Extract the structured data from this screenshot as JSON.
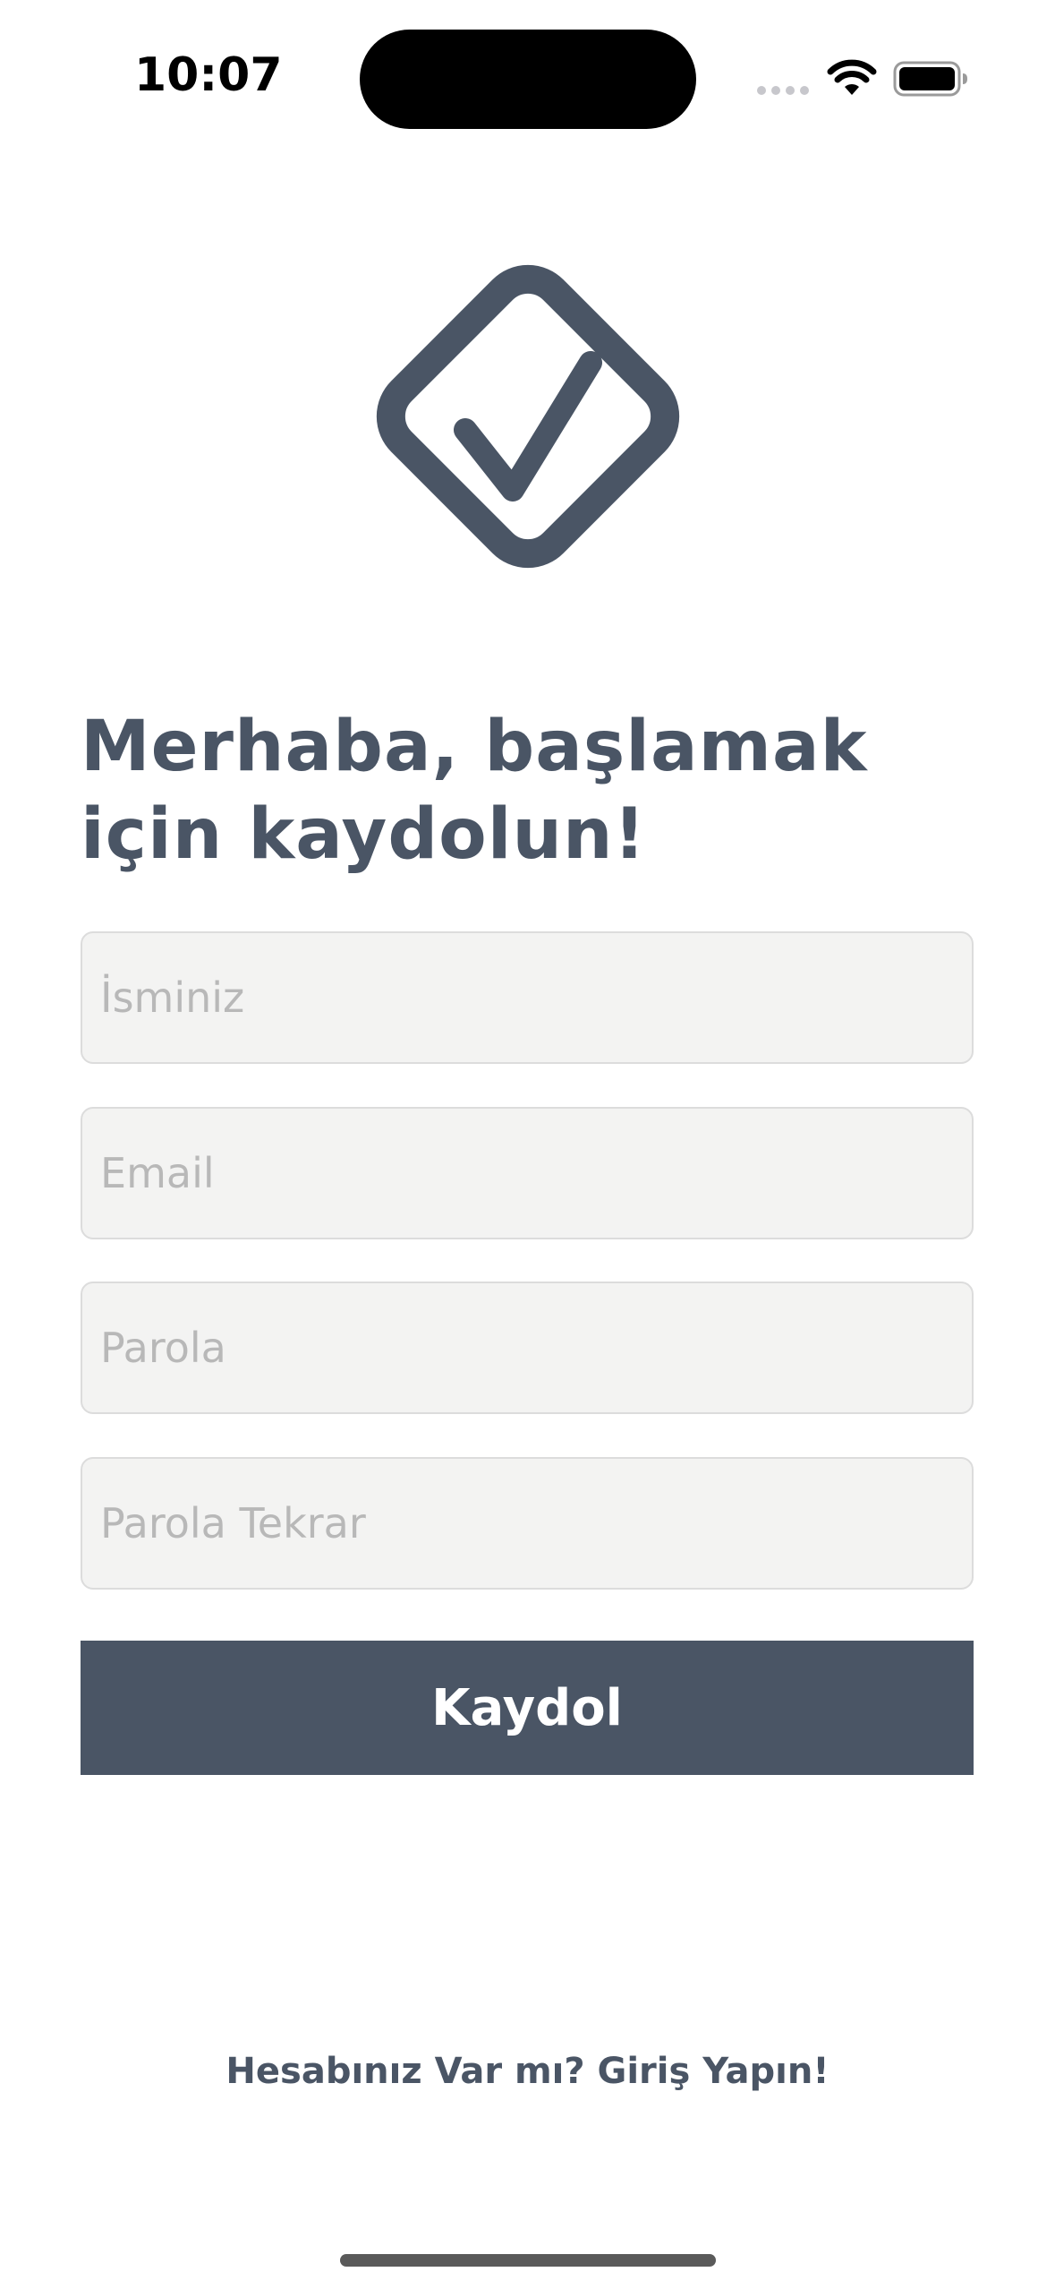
{
  "status_bar": {
    "time": "10:07",
    "wifi_icon": "wifi-icon",
    "battery_icon": "battery-icon"
  },
  "logo": {
    "icon": "checkmark-diamond-icon",
    "color": "#4a5565"
  },
  "heading": {
    "line1": "Merhaba, başlamak",
    "line2": "için kaydolun!"
  },
  "form": {
    "name": {
      "placeholder": "İsminiz",
      "value": ""
    },
    "email": {
      "placeholder": "Email",
      "value": ""
    },
    "password": {
      "placeholder": "Parola",
      "value": ""
    },
    "password_repeat": {
      "placeholder": "Parola Tekrar",
      "value": ""
    },
    "submit_label": "Kaydol"
  },
  "footer": {
    "login_link": "Hesabınız Var mı? Giriş Yapın!"
  },
  "colors": {
    "primary": "#4a5565",
    "field_background": "#f3f3f2",
    "field_border": "#dcdcdc",
    "placeholder": "#b8b8b8"
  }
}
